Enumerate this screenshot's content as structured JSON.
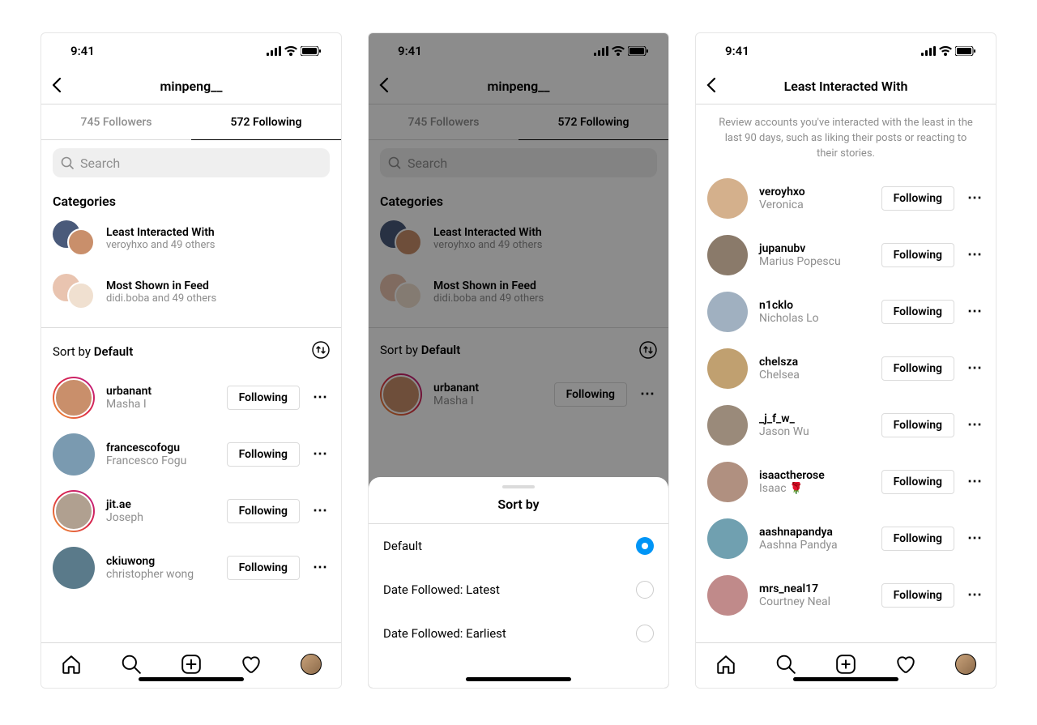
{
  "status": {
    "time": "9:41"
  },
  "profile": {
    "username": "minpeng__"
  },
  "tabs": {
    "followers": "745 Followers",
    "following": "572 Following"
  },
  "search": {
    "placeholder": "Search"
  },
  "categories": {
    "title": "Categories",
    "least": {
      "title": "Least Interacted With",
      "sub": "veroyhxo and 49 others"
    },
    "most": {
      "title": "Most Shown in Feed",
      "sub": "didi.boba and 49 others"
    }
  },
  "sort": {
    "prefix": "Sort by ",
    "value": "Default"
  },
  "following_list": [
    {
      "user": "urbanant",
      "name": "Masha I",
      "story": true,
      "button": "Following"
    },
    {
      "user": "francescofogu",
      "name": "Francesco Fogu",
      "story": false,
      "button": "Following"
    },
    {
      "user": "jit.ae",
      "name": "Joseph",
      "story": true,
      "button": "Following"
    },
    {
      "user": "ckiuwong",
      "name": "christopher wong",
      "story": false,
      "button": "Following"
    }
  ],
  "sort_sheet": {
    "title": "Sort by",
    "options": [
      {
        "label": "Default",
        "selected": true
      },
      {
        "label": "Date Followed: Latest",
        "selected": false
      },
      {
        "label": "Date Followed: Earliest",
        "selected": false
      }
    ]
  },
  "least_page": {
    "title": "Least Interacted With",
    "description": "Review accounts you've interacted with the least in the last 90 days, such as liking their posts or reacting to their stories.",
    "list": [
      {
        "user": "veroyhxo",
        "name": "Veronica",
        "button": "Following"
      },
      {
        "user": "jupanubv",
        "name": "Marius Popescu",
        "button": "Following"
      },
      {
        "user": "n1cklo",
        "name": "Nicholas Lo",
        "button": "Following"
      },
      {
        "user": "chelsza",
        "name": "Chelsea",
        "button": "Following"
      },
      {
        "user": "_j_f_w_",
        "name": "Jason Wu",
        "button": "Following"
      },
      {
        "user": "isaactherose",
        "name": "Isaac 🌹",
        "button": "Following"
      },
      {
        "user": "aashnapandya",
        "name": "Aashna Pandya",
        "button": "Following"
      },
      {
        "user": "mrs_neal17",
        "name": "Courtney Neal",
        "button": "Following"
      }
    ]
  },
  "avatar_colors": [
    "#c98f6b",
    "#7a9ab0",
    "#b0a090",
    "#5a7a8a",
    "#d4b08c",
    "#8a7a6a",
    "#a0b0c0",
    "#c0a070",
    "#9a8a7a",
    "#b09080",
    "#70a0b0",
    "#c08a8a"
  ]
}
